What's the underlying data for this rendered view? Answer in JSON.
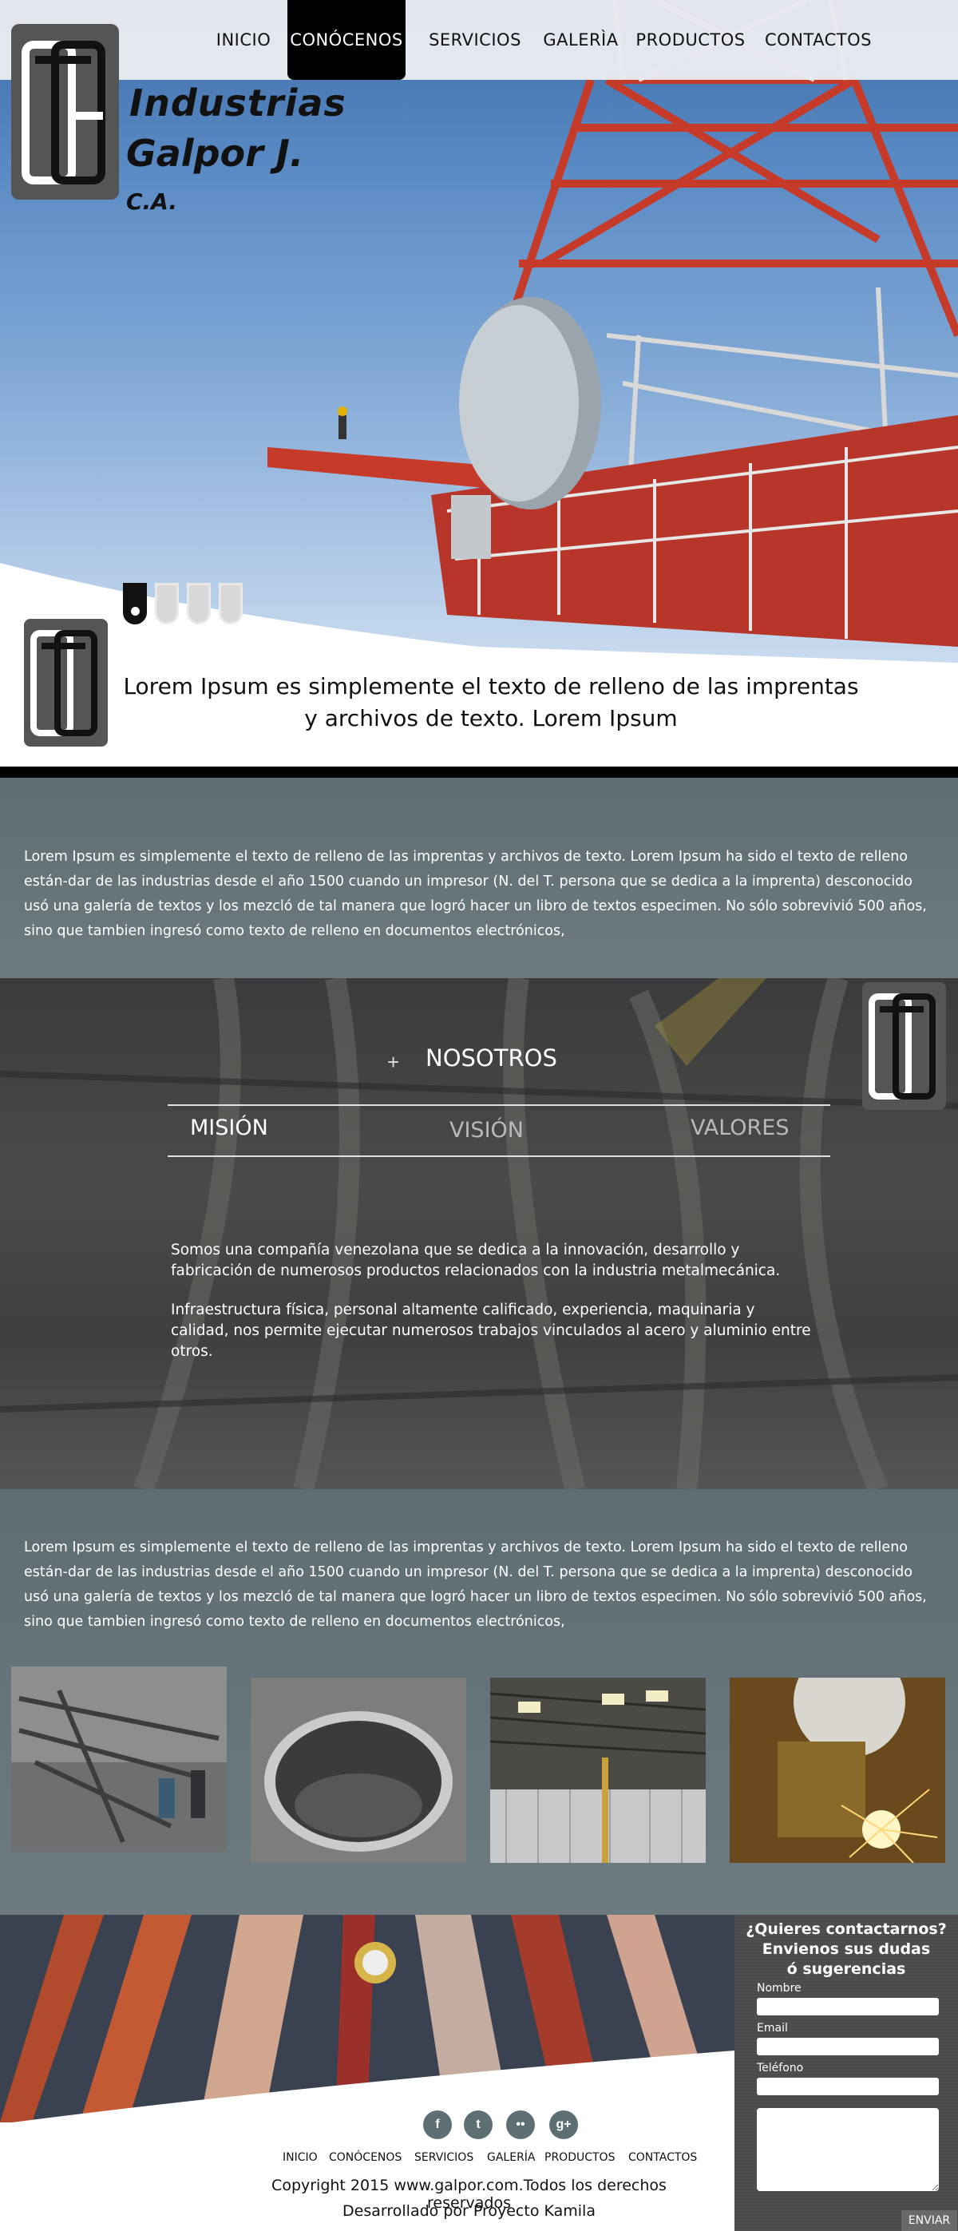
{
  "brand": {
    "name_line1": "Industrias",
    "name_line2": "Galpor J.",
    "suffix": "C.A."
  },
  "nav": {
    "items": [
      {
        "label": "INICIO",
        "active": false
      },
      {
        "label": "CONÓCENOS",
        "active": true
      },
      {
        "label": "SERVICIOS",
        "active": false
      },
      {
        "label": "GALERÌA",
        "active": false
      },
      {
        "label": "PRODUCTOS",
        "active": false
      },
      {
        "label": "CONTACTOS",
        "active": false
      }
    ]
  },
  "hero": {
    "slides": 4,
    "active_slide": 1,
    "caption": "Lorem Ipsum es simplemente el texto de relleno de las imprentas y archivos de texto. Lorem Ipsum"
  },
  "intro": {
    "paragraph": "Lorem Ipsum es simplemente el texto de relleno de las imprentas y archivos de texto. Lorem Ipsum ha sido el texto de relleno están-dar de las industrias desde el año 1500 cuando un impresor (N. del T. persona que se dedica a la imprenta) desconocido usó una galería de textos y los mezcló de tal manera que logró hacer un libro de textos especimen. No sólo sobrevivió 500 años, sino que tambien ingresó como texto de relleno en documentos electrónicos,"
  },
  "about": {
    "plus": "+",
    "title": "NOSOTROS",
    "tabs": [
      {
        "label": "MISIÓN",
        "active": true
      },
      {
        "label": "VISIÓN",
        "active": false
      },
      {
        "label": "VALORES",
        "active": false
      }
    ],
    "paragraph1": "Somos una compañía venezolana que se dedica a la innovación, desarrollo y fabricación de numerosos productos relacionados con la industria metalmecánica.",
    "paragraph2": "Infraestructura física, personal altamente calificado, experiencia, maquinaria y calidad, nos permite ejecutar numerosos trabajos vinculados al acero y aluminio entre otros."
  },
  "gallery": {
    "paragraph": "Lorem Ipsum es simplemente el texto de relleno de las imprentas y archivos de texto. Lorem Ipsum ha sido el texto de relleno están-dar de las industrias desde el año 1500 cuando un impresor (N. del T. persona que se dedica a la imprenta) desconocido usó una galería de textos y los mezcló de tal manera que logró hacer un libro de textos especimen. No sólo sobrevivió 500 años, sino que tambien ingresó como texto de relleno en documentos electrónicos,"
  },
  "footer": {
    "social": [
      {
        "icon": "facebook-icon",
        "glyph": "f"
      },
      {
        "icon": "twitter-icon",
        "glyph": "t"
      },
      {
        "icon": "flickr-icon",
        "glyph": "••"
      },
      {
        "icon": "googleplus-icon",
        "glyph": "g+"
      }
    ],
    "nav": [
      "INICIO",
      "CONÓCENOS",
      "SERVICIOS",
      "GALERÍA",
      "PRODUCTOS",
      "CONTACTOS"
    ],
    "copyright": "Copyright  2015 www.galpor.com.Todos los derechos reservados",
    "developer": "Desarrollado por Proyecto Kamila"
  },
  "contact": {
    "title_line1": "¿Quieres contactarnos?",
    "title_line2": "Envienos sus dudas",
    "title_line3": "ó sugerencias",
    "name_label": "Nombre",
    "email_label": "Email",
    "phone_label": "Teléfono",
    "name_value": "",
    "email_value": "",
    "phone_value": "",
    "message_value": "",
    "send_label": "ENVIAR"
  },
  "colors": {
    "section_gray": "#5e6d73",
    "nav_active": "#000000",
    "tower_red": "#c63a2a"
  }
}
